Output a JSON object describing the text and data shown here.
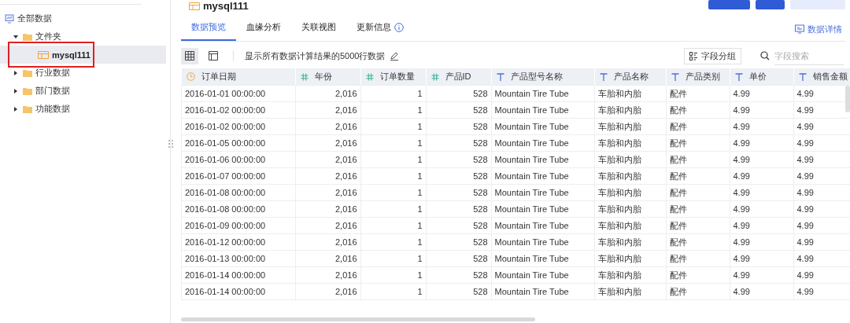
{
  "sidebar": {
    "tree": [
      {
        "label": "全部数据",
        "kind": "root",
        "selected": false,
        "children": [
          {
            "label": "文件夹",
            "kind": "folder",
            "expanded": true,
            "selected": false,
            "children": [
              {
                "label": "mysql111",
                "kind": "table",
                "selected": true,
                "highlighted": true
              }
            ]
          },
          {
            "label": "行业数据",
            "kind": "folder",
            "expanded": false,
            "selected": false
          },
          {
            "label": "部门数据",
            "kind": "folder",
            "expanded": false,
            "selected": false
          },
          {
            "label": "功能数据",
            "kind": "folder",
            "expanded": false,
            "selected": false
          }
        ]
      }
    ]
  },
  "header": {
    "title": "mysql111",
    "buttons": [
      {
        "kind": "primary"
      },
      {
        "kind": "primary"
      },
      {
        "kind": "light"
      }
    ]
  },
  "tabs": [
    {
      "label": "数据预览",
      "selected": true,
      "info": false
    },
    {
      "label": "血缘分析",
      "selected": false,
      "info": false
    },
    {
      "label": "关联视图",
      "selected": false,
      "info": false
    },
    {
      "label": "更新信息",
      "selected": false,
      "info": true
    }
  ],
  "details_link": "数据详情",
  "toolbar": {
    "views": [
      {
        "kind": "grid",
        "selected": true
      },
      {
        "kind": "layout",
        "selected": false
      }
    ],
    "note": "显示所有数据计算结果的5000行数据",
    "group_button": "字段分组",
    "search": {
      "placeholder": "字段搜索"
    }
  },
  "table": {
    "columns": [
      {
        "label": "订单日期",
        "kind": "date"
      },
      {
        "label": "年份",
        "kind": "number"
      },
      {
        "label": "订单数量",
        "kind": "number"
      },
      {
        "label": "产品ID",
        "kind": "number"
      },
      {
        "label": "产品型号名称",
        "kind": "text"
      },
      {
        "label": "产品名称",
        "kind": "text"
      },
      {
        "label": "产品类别",
        "kind": "text"
      },
      {
        "label": "单价",
        "kind": "text"
      },
      {
        "label": "销售金额",
        "kind": "text"
      }
    ],
    "rows": [
      [
        "2016-01-01 00:00:00",
        "2,016",
        "1",
        "528",
        "Mountain Tire Tube",
        "车胎和内胎",
        "配件",
        "4.99",
        "4.99"
      ],
      [
        "2016-01-02 00:00:00",
        "2,016",
        "1",
        "528",
        "Mountain Tire Tube",
        "车胎和内胎",
        "配件",
        "4.99",
        "4.99"
      ],
      [
        "2016-01-02 00:00:00",
        "2,016",
        "1",
        "528",
        "Mountain Tire Tube",
        "车胎和内胎",
        "配件",
        "4.99",
        "4.99"
      ],
      [
        "2016-01-05 00:00:00",
        "2,016",
        "1",
        "528",
        "Mountain Tire Tube",
        "车胎和内胎",
        "配件",
        "4.99",
        "4.99"
      ],
      [
        "2016-01-06 00:00:00",
        "2,016",
        "1",
        "528",
        "Mountain Tire Tube",
        "车胎和内胎",
        "配件",
        "4.99",
        "4.99"
      ],
      [
        "2016-01-07 00:00:00",
        "2,016",
        "1",
        "528",
        "Mountain Tire Tube",
        "车胎和内胎",
        "配件",
        "4.99",
        "4.99"
      ],
      [
        "2016-01-08 00:00:00",
        "2,016",
        "1",
        "528",
        "Mountain Tire Tube",
        "车胎和内胎",
        "配件",
        "4.99",
        "4.99"
      ],
      [
        "2016-01-08 00:00:00",
        "2,016",
        "1",
        "528",
        "Mountain Tire Tube",
        "车胎和内胎",
        "配件",
        "4.99",
        "4.99"
      ],
      [
        "2016-01-09 00:00:00",
        "2,016",
        "1",
        "528",
        "Mountain Tire Tube",
        "车胎和内胎",
        "配件",
        "4.99",
        "4.99"
      ],
      [
        "2016-01-12 00:00:00",
        "2,016",
        "1",
        "528",
        "Mountain Tire Tube",
        "车胎和内胎",
        "配件",
        "4.99",
        "4.99"
      ],
      [
        "2016-01-13 00:00:00",
        "2,016",
        "1",
        "528",
        "Mountain Tire Tube",
        "车胎和内胎",
        "配件",
        "4.99",
        "4.99"
      ],
      [
        "2016-01-14 00:00:00",
        "2,016",
        "1",
        "528",
        "Mountain Tire Tube",
        "车胎和内胎",
        "配件",
        "4.99",
        "4.99"
      ],
      [
        "2016-01-14 00:00:00",
        "2,016",
        "1",
        "528",
        "Mountain Tire Tube",
        "车胎和内胎",
        "配件",
        "4.99",
        "4.99"
      ]
    ]
  }
}
